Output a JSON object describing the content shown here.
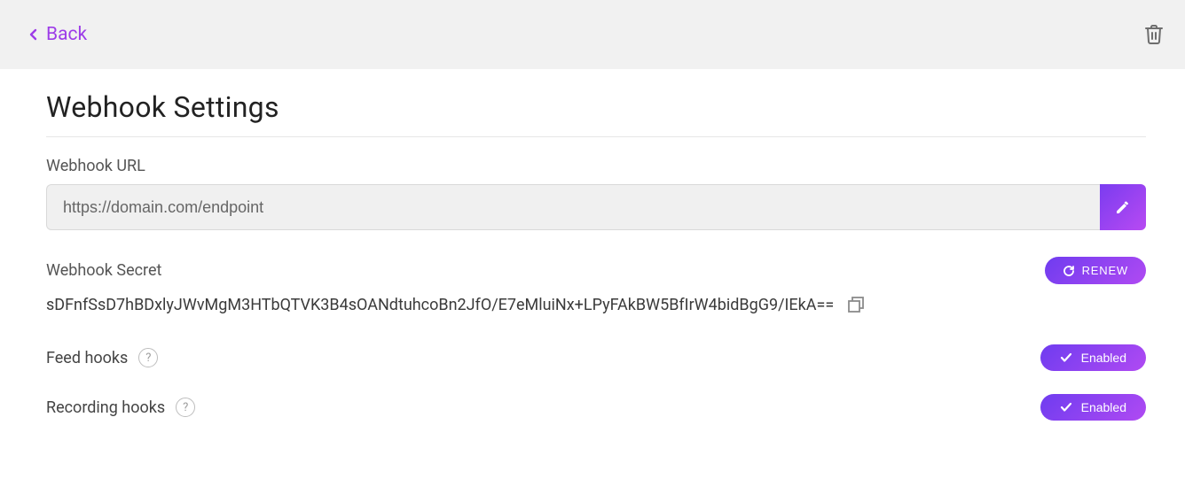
{
  "topbar": {
    "back_label": "Back"
  },
  "page": {
    "title": "Webhook Settings"
  },
  "webhook_url": {
    "label": "Webhook URL",
    "value": "https://domain.com/endpoint"
  },
  "webhook_secret": {
    "label": "Webhook Secret",
    "value": "sDFnfSsD7hBDxlyJWvMgM3HTbQTVK3B4sOANdtuhcoBn2JfO/E7eMluiNx+LPyFAkBW5BfIrW4bidBgG9/IEkA==",
    "renew_label": "Renew"
  },
  "feed_hooks": {
    "label": "Feed hooks",
    "status_label": "Enabled"
  },
  "recording_hooks": {
    "label": "Recording hooks",
    "status_label": "Enabled"
  }
}
